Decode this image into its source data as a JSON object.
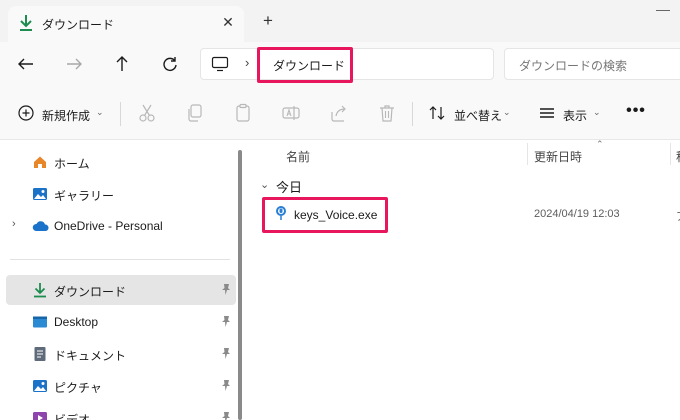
{
  "tab": {
    "title": "ダウンロード",
    "close_glyph": "✕",
    "new_tab_glyph": "+",
    "icon": "download-arrow-icon"
  },
  "nav": {
    "back_icon": "arrow-left-icon",
    "forward_icon": "arrow-right-icon",
    "up_icon": "arrow-up-icon",
    "refresh_icon": "refresh-icon",
    "pc_icon": "monitor-icon",
    "chevron": "›",
    "address": "ダウンロード",
    "search_placeholder": "ダウンロードの検索"
  },
  "toolbar": {
    "new_label": "新規作成",
    "sort_label": "並べ替え",
    "view_label": "表示",
    "more_glyph": "•••",
    "dropdown_glyph": "⌄",
    "icons": [
      "plus-circle-icon",
      "cut-icon",
      "copy-icon",
      "paste-icon",
      "rename-icon",
      "share-icon",
      "delete-icon",
      "sort-icon",
      "view-icon"
    ]
  },
  "sidebar": {
    "items": [
      {
        "label": "ホーム",
        "icon": "home-icon"
      },
      {
        "label": "ギャラリー",
        "icon": "gallery-icon"
      },
      {
        "label": "OneDrive - Personal",
        "icon": "onedrive-cloud-icon",
        "expand": "›"
      },
      {
        "label": "ダウンロード",
        "icon": "download-arrow-icon",
        "pinned": true,
        "selected": true
      },
      {
        "label": "Desktop",
        "icon": "desktop-icon",
        "pinned": true
      },
      {
        "label": "ドキュメント",
        "icon": "document-icon",
        "pinned": true
      },
      {
        "label": "ピクチャ",
        "icon": "pictures-icon",
        "pinned": true
      },
      {
        "label": "ビデオ",
        "icon": "video-icon",
        "pinned": true
      }
    ]
  },
  "content": {
    "columns": {
      "name": "名前",
      "date": "更新日時",
      "sort_glyph": "⌃",
      "cut_col": "種"
    },
    "group": {
      "label": "今日",
      "chevron": "⌄"
    },
    "files": [
      {
        "name": "keys_Voice.exe",
        "date": "2024/04/19 12:03",
        "icon": "exe-voice-app-icon",
        "cut": "ア"
      }
    ]
  },
  "colors": {
    "highlight": "#e8175d",
    "accent_green": "#1e8b4f",
    "folder_blue": "#1a73c8",
    "home_orange": "#e8862a"
  }
}
